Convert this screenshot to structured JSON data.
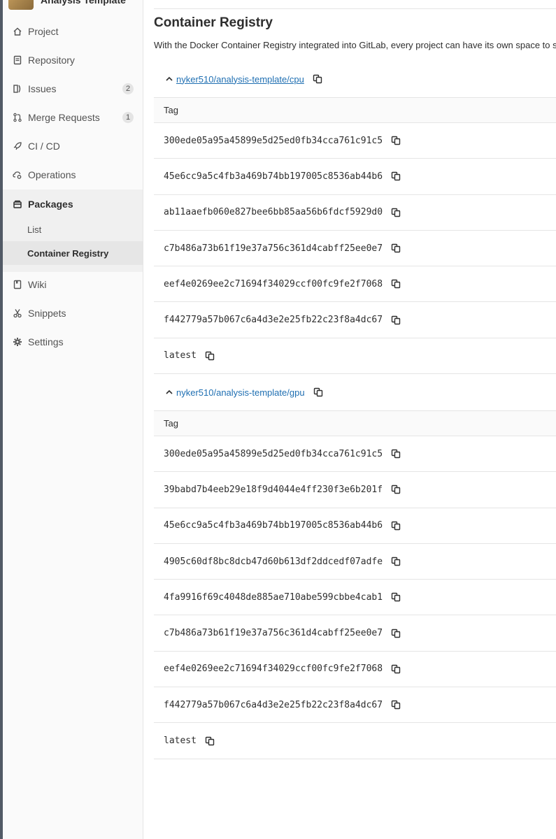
{
  "project": {
    "name": "Analysis Template"
  },
  "sidebar": {
    "items": [
      {
        "label": "Project",
        "icon": "home-icon"
      },
      {
        "label": "Repository",
        "icon": "document-icon"
      },
      {
        "label": "Issues",
        "icon": "issues-icon",
        "badge": "2"
      },
      {
        "label": "Merge Requests",
        "icon": "merge-request-icon",
        "badge": "1"
      },
      {
        "label": "CI / CD",
        "icon": "rocket-icon"
      },
      {
        "label": "Operations",
        "icon": "cloud-gear-icon"
      },
      {
        "label": "Packages",
        "icon": "package-icon"
      },
      {
        "label": "Wiki",
        "icon": "book-icon"
      },
      {
        "label": "Snippets",
        "icon": "scissors-icon"
      },
      {
        "label": "Settings",
        "icon": "gear-icon"
      }
    ],
    "packages_sub": [
      "List",
      "Container Registry"
    ]
  },
  "main": {
    "title": "Container Registry",
    "description": "With the Docker Container Registry integrated into GitLab, every project can have its own space to sto"
  },
  "repos": [
    {
      "name": " nyker510/analysis-template/cpu",
      "tag_header": "Tag",
      "tags": [
        "300ede05a95a45899e5d25ed0fb34cca761c91c5",
        "45e6cc9a5c4fb3a469b74bb197005c8536ab44b6",
        "ab11aaefb060e827bee6bb85aa56b6fdcf5929d0",
        "c7b486a73b61f19e37a756c361d4cabff25ee0e7",
        "eef4e0269ee2c71694f34029ccf00fc9fe2f7068",
        "f442779a57b067c6a4d3e2e25fb22c23f8a4dc67",
        "latest"
      ]
    },
    {
      "name": "nyker510/analysis-template/gpu",
      "tag_header": "Tag",
      "tags": [
        "300ede05a95a45899e5d25ed0fb34cca761c91c5",
        "39babd7b4eeb29e18f9d4044e4ff230f3e6b201f",
        "45e6cc9a5c4fb3a469b74bb197005c8536ab44b6",
        "4905c60df8bc8dcb47d60b613df2ddcedf07adfe",
        "4fa9916f69c4048de885ae710abe599cbbe4cab1",
        "c7b486a73b61f19e37a756c361d4cabff25ee0e7",
        "eef4e0269ee2c71694f34029ccf00fc9fe2f7068",
        "f442779a57b067c6a4d3e2e25fb22c23f8a4dc67",
        "latest"
      ]
    }
  ],
  "colors": {
    "link": "#1f6fb2",
    "sidebar_bg": "#fafafa",
    "active_bg": "#e6e6e6"
  }
}
